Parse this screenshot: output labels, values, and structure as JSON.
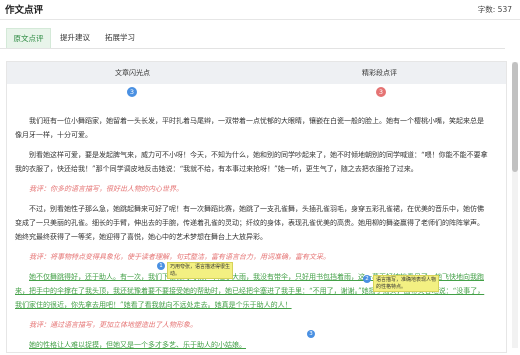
{
  "header": {
    "title": "作文点评",
    "word_count": "字数: 537"
  },
  "tabs": [
    {
      "label": "原文点评",
      "active": true
    },
    {
      "label": "提升建议",
      "active": false
    },
    {
      "label": "拓展学习",
      "active": false
    }
  ],
  "columns": {
    "left_title": "文章闪光点",
    "left_count": "3",
    "right_title": "精彩段点评",
    "right_count": "3"
  },
  "essay": {
    "p1": "我们班有一位小舞蹈家，她留着一头长发，平时扎着马尾辫，一双带着一点忧郁的大眼睛，镶嵌在白瓷一般的脸上。她有一个樱桃小嘴，笑起来总是像月牙一样，十分可爱。",
    "p2": "别看她这样可爱，要是发起脾气来，威力可不小呀！今天，不知为什么，她和别的同学吵起来了，她不时倾地朝别的同学喊道：“喂！你能不能不要拿我的衣服了，快还给我！”那个同学调皮地反击她说：“我就不给，有本事过来抢呀！”她一听，更生气了，随之去把衣服抢了过来。",
    "c1": "我评：你多的语言描写，很好出人物的内心世界。",
    "p3": "不过，别看她性子那么急，她跳起舞来可好了呢！有一次舞蹈比赛，她跳了一支孔雀舞，头插孔雀羽毛，身穿五彩孔雀裙，在优美的音乐中，她仿佛变成了一只美丽的孔雀。细长的手臂，伸出去的手腕，传递着孔雀的灵动；纤纹的身体，表现孔雀优美的高贵。她用柳的舞姿赢得了老师们的阵阵掌声。她终究最终获得了一等奖，她迎得了喜悦，她心中的艺术梦想在舞台上大放异彩。",
    "c2": "我评：将事物特点变得具象化，使于读者理解，句式整洁，富有语言台力，用词准确，富有文采。",
    "p4_hl": "她不仅舞跳得好，还于助人。",
    "p4_rest": "有一次，我们下楼梯的时候，下起了大雨，我没有带伞，只好用书包挡着雨，这一幕正好被她看见了，她飞快地向我跑来，把手中的伞撑在了我头顶，我还犹豫着要不要接受她的帮助时，她已经把伞塞进了我手里：“不用了，谢谢。”她摇了摇头，面带笑容地说：“没事了，我们家住的很近，你先拿去用吧！”她看了看我就向不远处走去。她真是个乐于助人的人！",
    "c3": "我评：通过语言描写，更加立体地塑造出了人物形象。",
    "p5": "她的性格让人难以捉摸，但她又是一个多才多艺、乐于助人的小姑娘。"
  },
  "tips": [
    {
      "num": "1",
      "text": "巧用夸张，语言描述得很生动。"
    },
    {
      "num": "2",
      "text": "语言描写，描述生动，表现人物的形象。"
    },
    {
      "num": "3",
      "text": "语言描写，准确地表现人物的性格特点。"
    }
  ],
  "colors": {
    "accent_green": "#43a047",
    "comment_red": "#e57373",
    "badge_blue": "#4a90e2",
    "tip_yellow": "#f3f082"
  }
}
